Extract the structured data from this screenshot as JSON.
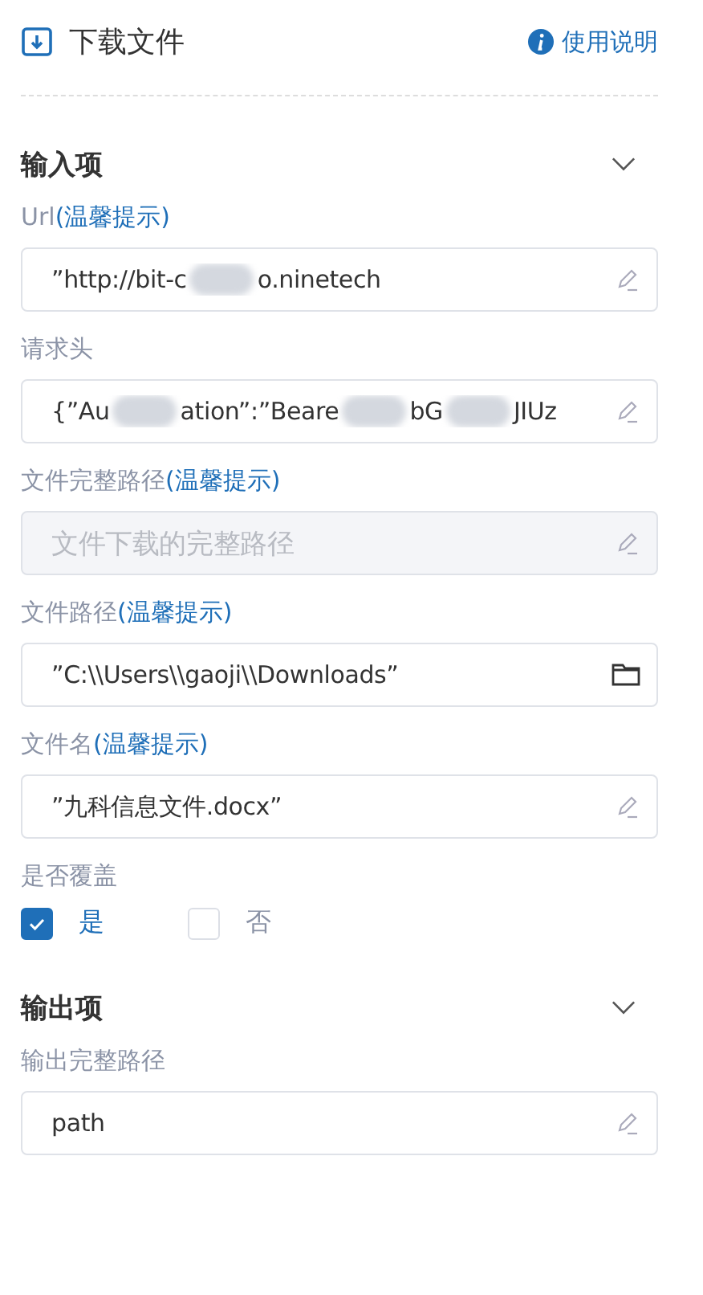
{
  "header": {
    "title": "下载文件",
    "help_link": "使用说明"
  },
  "input_section": {
    "title": "输入项",
    "expanded": true,
    "fields": [
      {
        "label": "Url",
        "hint": "(温馨提示)",
        "kind": "edit",
        "disabled": false,
        "segments": [
          "”http://bit-c",
          "o.ninetech"
        ]
      },
      {
        "label": "请求头",
        "kind": "edit",
        "disabled": false,
        "segments": [
          "{”Au",
          "ation”:”Beare",
          "bG",
          "JIUz"
        ]
      },
      {
        "label": "文件完整路径",
        "hint": "(温馨提示)",
        "kind": "edit",
        "disabled": true,
        "placeholder": "文件下载的完整路径"
      },
      {
        "label": "文件路径",
        "hint": "(温馨提示)",
        "kind": "folder",
        "disabled": false,
        "segments": [
          "”C:\\\\Users\\\\gaoji\\\\Downloads”"
        ]
      },
      {
        "label": "文件名",
        "hint": "(温馨提示)",
        "kind": "edit",
        "disabled": false,
        "segments": [
          "”九科信息文件.docx”"
        ]
      }
    ],
    "overwrite": {
      "label": "是否覆盖",
      "options": [
        {
          "label": "是",
          "selected": true
        },
        {
          "label": "否",
          "selected": false
        }
      ]
    }
  },
  "output_section": {
    "title": "输出项",
    "expanded": true,
    "fields": [
      {
        "label": "输出完整路径",
        "kind": "edit",
        "disabled": false,
        "segments": [
          "path"
        ]
      }
    ]
  }
}
